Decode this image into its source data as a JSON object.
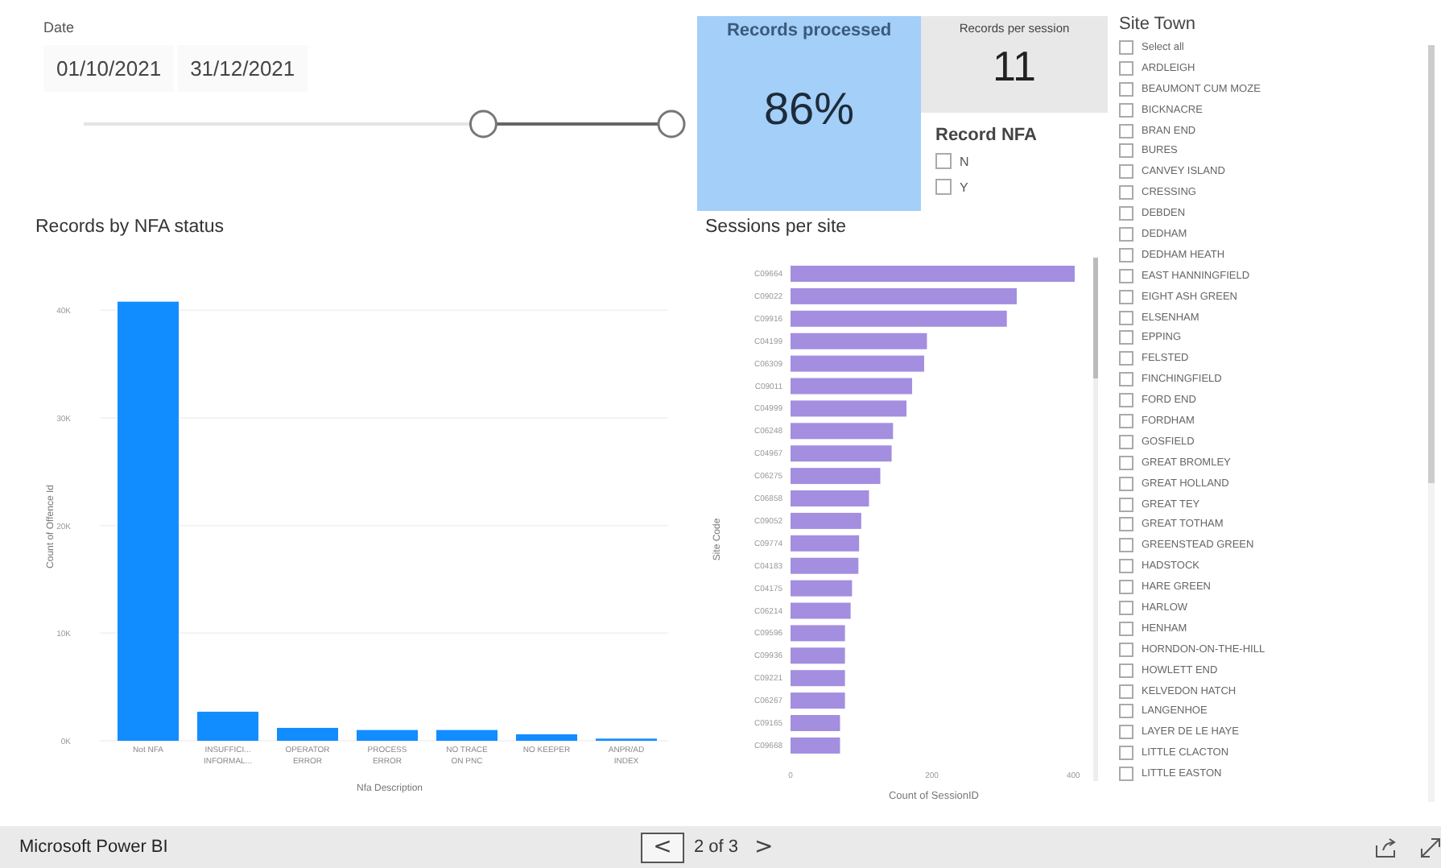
{
  "date_slicer": {
    "title": "Date",
    "start": "01/10/2021",
    "end": "31/12/2021",
    "low": {
      "level": 0.68
    },
    "high": {
      "level": 1
    }
  },
  "records_processed": {
    "title": "Records processed",
    "value": "86%"
  },
  "records_per_session": {
    "title": "Records per session",
    "value": "11"
  },
  "record_nfa": {
    "title": "Record NFA",
    "options": [
      {
        "label": "N",
        "checked": false
      },
      {
        "label": "Y",
        "checked": false
      }
    ]
  },
  "nfa_chart": {
    "title": "Records by NFA status",
    "chart_data": {
      "type": "bar",
      "xlabel": "Nfa Description",
      "ylabel": "Count of Offence Id",
      "categories": [
        "Not NFA",
        "INSUFFICI...\nINFORMAL...",
        "OPERATOR\nERROR",
        "PROCESS\nERROR",
        "NO TRACE\nON PNC",
        "NO KEEPER",
        "ANPR/AD\nINDEX"
      ],
      "series": [
        {
          "color": "#118dff",
          "values": [
            40.8,
            2.7,
            1.2,
            1.0,
            1.0,
            0.6,
            0.2
          ]
        }
      ],
      "ylim": [
        0,
        41
      ],
      "grid": true,
      "yticks": [
        {
          "value": 0,
          "label": "0K"
        },
        {
          "value": 10,
          "label": "10K"
        },
        {
          "value": 20,
          "label": "20K"
        },
        {
          "value": 30,
          "label": "30K"
        },
        {
          "value": 40,
          "label": "40K"
        }
      ]
    }
  },
  "sessions_chart": {
    "title": "Sessions per site",
    "chart_data": {
      "type": "bar",
      "orientation": "horizontal",
      "xlabel": "Count of SessionID",
      "ylabel": "Site Code",
      "categories": [
        "C09664",
        "C09022",
        "C09916",
        "C04199",
        "C06309",
        "C09011",
        "C04999",
        "C06248",
        "C04967",
        "C06275",
        "C06858",
        "C09052",
        "C09774",
        "C04183",
        "C04175",
        "C06214",
        "C09596",
        "C09936",
        "C09221",
        "C06267",
        "C09165",
        "C09668"
      ],
      "series": [
        {
          "color": "#a38ee0",
          "values": [
            402,
            320,
            306,
            193,
            189,
            172,
            164,
            145,
            143,
            127,
            111,
            100,
            97,
            96,
            87,
            85,
            77,
            77,
            77,
            77,
            70,
            70
          ]
        }
      ],
      "xticks": [
        0,
        200,
        400
      ],
      "xlim": [
        0,
        410
      ]
    }
  },
  "site_town": {
    "title": "Site Town",
    "items": [
      {
        "label": "Select all",
        "checked": false
      },
      {
        "label": "ARDLEIGH",
        "checked": false
      },
      {
        "label": "BEAUMONT CUM MOZE",
        "checked": false
      },
      {
        "label": "BICKNACRE",
        "checked": false
      },
      {
        "label": "BRAN END",
        "checked": false
      },
      {
        "label": "BURES",
        "checked": false
      },
      {
        "label": "CANVEY ISLAND",
        "checked": false
      },
      {
        "label": "CRESSING",
        "checked": false
      },
      {
        "label": "DEBDEN",
        "checked": false
      },
      {
        "label": "DEDHAM",
        "checked": false
      },
      {
        "label": "DEDHAM HEATH",
        "checked": false
      },
      {
        "label": "EAST HANNINGFIELD",
        "checked": false
      },
      {
        "label": "EIGHT ASH GREEN",
        "checked": false
      },
      {
        "label": "ELSENHAM",
        "checked": false
      },
      {
        "label": "EPPING",
        "checked": false
      },
      {
        "label": "FELSTED",
        "checked": false
      },
      {
        "label": "FINCHINGFIELD",
        "checked": false
      },
      {
        "label": "FORD END",
        "checked": false
      },
      {
        "label": "FORDHAM",
        "checked": false
      },
      {
        "label": "GOSFIELD",
        "checked": false
      },
      {
        "label": "GREAT BROMLEY",
        "checked": false
      },
      {
        "label": "GREAT HOLLAND",
        "checked": false
      },
      {
        "label": "GREAT TEY",
        "checked": false
      },
      {
        "label": "GREAT TOTHAM",
        "checked": false
      },
      {
        "label": "GREENSTEAD GREEN",
        "checked": false
      },
      {
        "label": "HADSTOCK",
        "checked": false
      },
      {
        "label": "HARE GREEN",
        "checked": false
      },
      {
        "label": "HARLOW",
        "checked": false
      },
      {
        "label": "HENHAM",
        "checked": false
      },
      {
        "label": "HORNDON-ON-THE-HILL",
        "checked": false
      },
      {
        "label": "HOWLETT END",
        "checked": false
      },
      {
        "label": "KELVEDON HATCH",
        "checked": false
      },
      {
        "label": "LANGENHOE",
        "checked": false
      },
      {
        "label": "LAYER DE LE HAYE",
        "checked": false
      },
      {
        "label": "LITTLE CLACTON",
        "checked": false
      },
      {
        "label": "LITTLE EASTON",
        "checked": false
      }
    ]
  },
  "footer": {
    "brand": "Microsoft Power BI",
    "prev": "<",
    "page": "2 of 3",
    "next": ">"
  }
}
